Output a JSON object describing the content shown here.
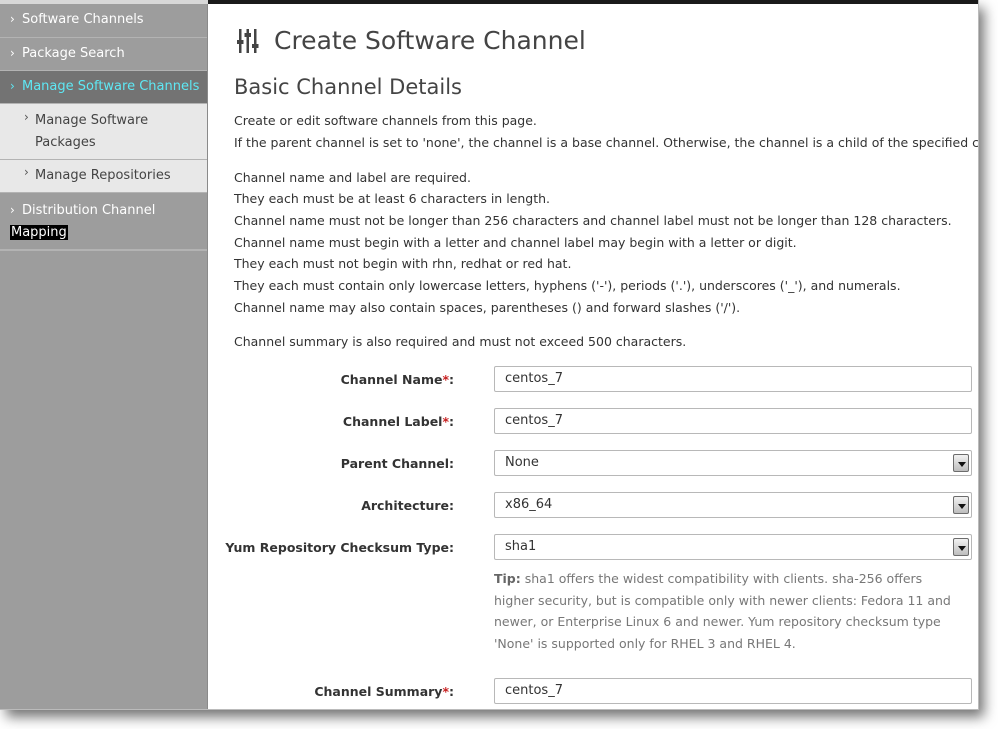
{
  "sidebar": {
    "items": [
      {
        "label": "Software Channels"
      },
      {
        "label": "Package Search"
      },
      {
        "label": "Manage Software Channels"
      },
      {
        "label": "Manage Software Packages"
      },
      {
        "label": "Manage Repositories"
      },
      {
        "label_line1": "Distribution Channel",
        "label_line2": "Mapping"
      }
    ],
    "chevron": "›"
  },
  "page": {
    "title": "Create Software Channel",
    "title_icon": "sliders-icon",
    "section_title": "Basic Channel Details"
  },
  "intro": {
    "line1": "Create or edit software channels from this page.",
    "line2": "If the parent channel is set to 'none', the channel is a base channel. Otherwise, the channel is a child of the specified channel."
  },
  "rules": {
    "r1": "Channel name and label are required.",
    "r2": "They each must be at least 6 characters in length.",
    "r3": "Channel name must not be longer than 256 characters and channel label must not be longer than 128 characters.",
    "r4": "Channel name must begin with a letter and channel label may begin with a letter or digit.",
    "r5": "They each must not begin with rhn, redhat or red hat.",
    "r6": "They each must contain only lowercase letters, hyphens ('-'), periods ('.'), underscores ('_'), and numerals.",
    "r7": "Channel name may also contain spaces, parentheses () and forward slashes ('/').",
    "summary_rule": "Channel summary is also required and must not exceed 500 characters."
  },
  "form": {
    "required_mark": "*",
    "channel_name": {
      "label": "Channel Name",
      "value": "centos_7"
    },
    "channel_label": {
      "label": "Channel Label",
      "value": "centos_7"
    },
    "parent_channel": {
      "label": "Parent Channel:",
      "value": "None"
    },
    "architecture": {
      "label": "Architecture:",
      "value": "x86_64"
    },
    "checksum": {
      "label": "Yum Repository Checksum Type:",
      "value": "sha1"
    },
    "tip_label": "Tip:",
    "tip_text": "sha1 offers the widest compatibility with clients. sha-256 offers higher security, but is compatible only with newer clients: Fedora 11 and newer, or Enterprise Linux 6 and newer. Yum repository checksum type 'None' is supported only for RHEL 3 and RHEL 4.",
    "channel_summary": {
      "label": "Channel Summary",
      "value": "centos_7"
    }
  }
}
